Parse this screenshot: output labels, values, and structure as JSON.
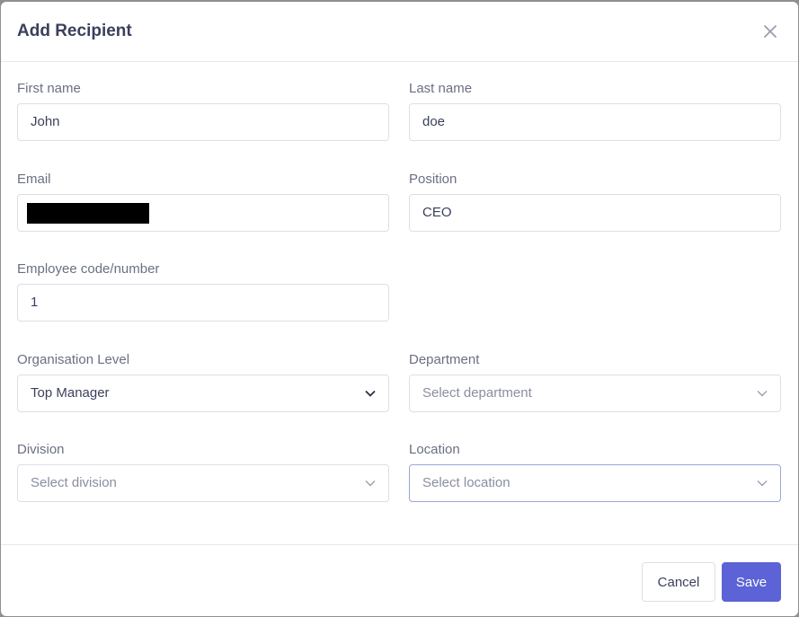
{
  "modal": {
    "title": "Add Recipient"
  },
  "form": {
    "first_name": {
      "label": "First name",
      "value": "John"
    },
    "last_name": {
      "label": "Last name",
      "value": "doe"
    },
    "email": {
      "label": "Email",
      "value": ""
    },
    "position": {
      "label": "Position",
      "value": "CEO"
    },
    "employee_code": {
      "label": "Employee code/number",
      "value": "1"
    },
    "organisation_level": {
      "label": "Organisation Level",
      "value": "Top Manager"
    },
    "department": {
      "label": "Department",
      "placeholder": "Select department"
    },
    "division": {
      "label": "Division",
      "placeholder": "Select division"
    },
    "location": {
      "label": "Location",
      "placeholder": "Select location"
    }
  },
  "footer": {
    "cancel_label": "Cancel",
    "save_label": "Save"
  },
  "colors": {
    "primary": "#5b63d6",
    "title": "#3b3f5c",
    "label": "#6b6f82",
    "border": "#dcdfe6"
  }
}
